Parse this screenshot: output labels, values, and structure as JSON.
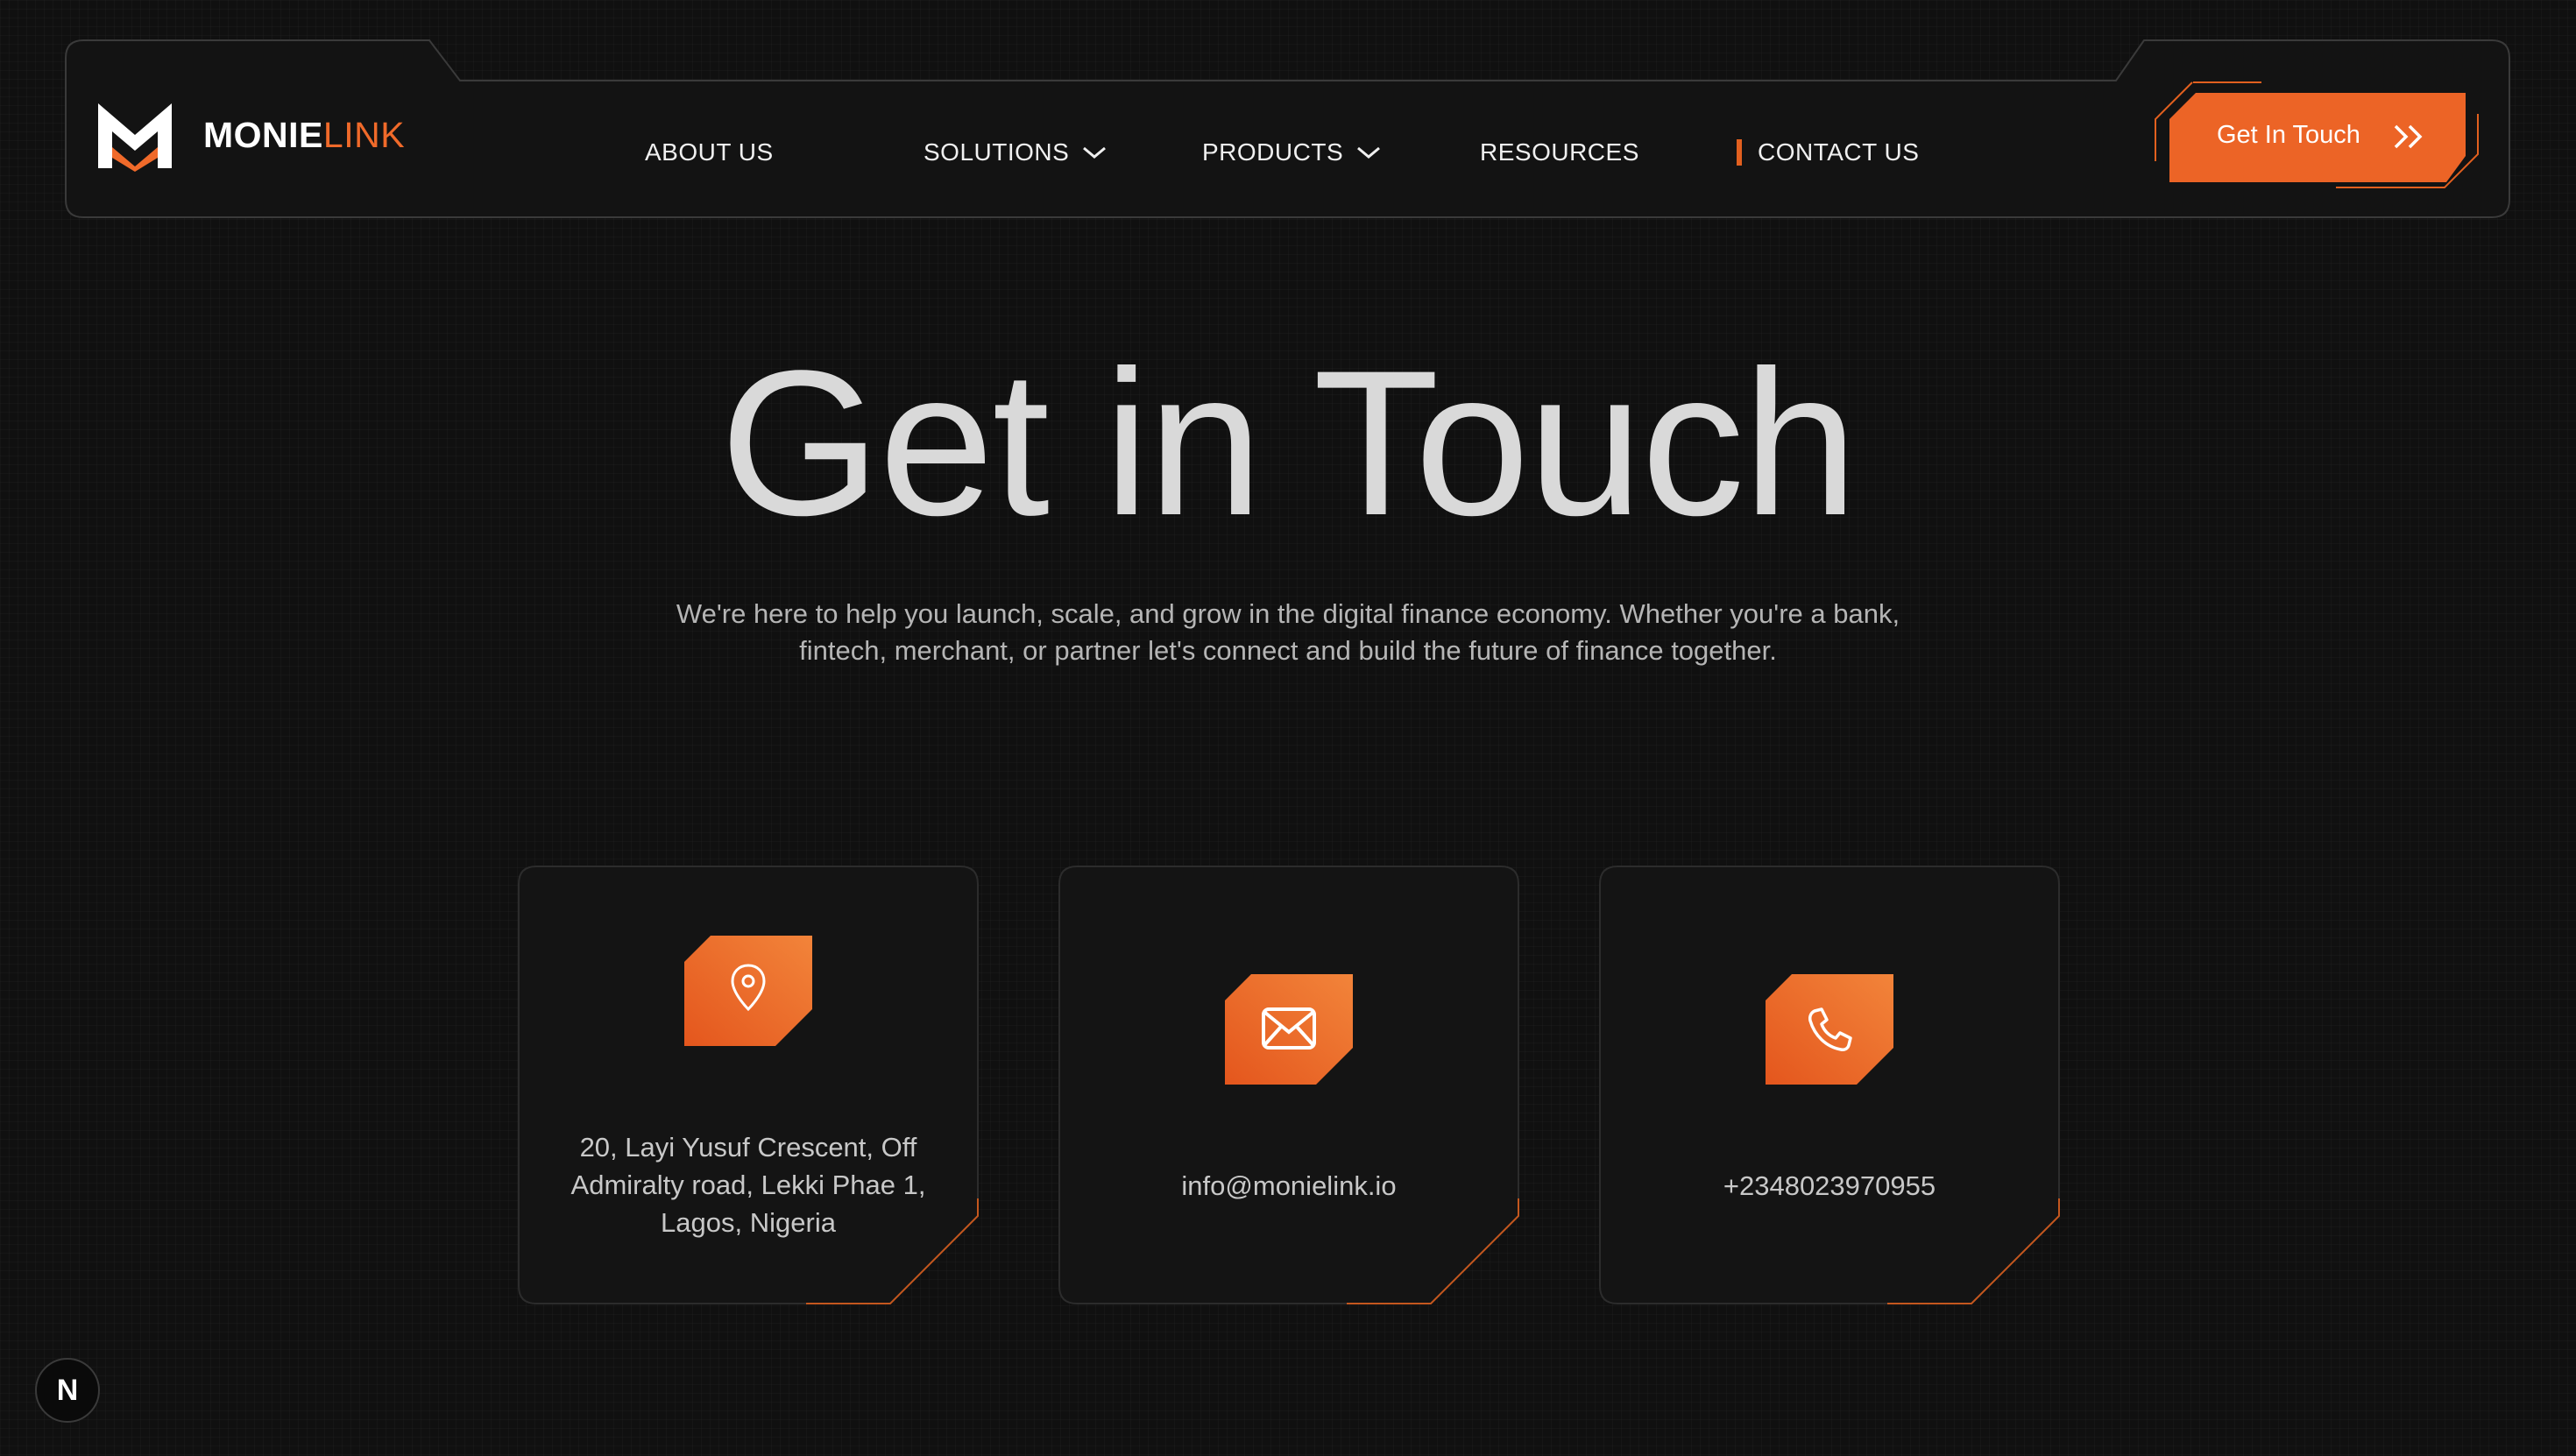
{
  "brand": {
    "name_bold": "MONIE",
    "name_light": "LINK",
    "accent_color": "#f06a2a"
  },
  "nav": {
    "items": [
      {
        "label": "ABOUT US",
        "has_dropdown": false,
        "active": false
      },
      {
        "label": "SOLUTIONS",
        "has_dropdown": true,
        "active": false
      },
      {
        "label": "PRODUCTS",
        "has_dropdown": true,
        "active": false
      },
      {
        "label": "RESOURCES",
        "has_dropdown": false,
        "active": false
      },
      {
        "label": "CONTACT US",
        "has_dropdown": false,
        "active": true
      }
    ],
    "cta_label": "Get In Touch",
    "cta_icon": "double-chevron-right-icon"
  },
  "hero": {
    "title": "Get in Touch",
    "subtitle": "We're here to help you launch, scale, and grow in the digital finance economy. Whether you're a bank, fintech, merchant, or partner let's connect and build the future of finance together."
  },
  "contacts": [
    {
      "icon": "location-pin-icon",
      "text": "20, Layi Yusuf Crescent, Off Admiralty road, Lekki Phae 1, Lagos, Nigeria"
    },
    {
      "icon": "mail-icon",
      "text": "info@monielink.io"
    },
    {
      "icon": "phone-icon",
      "text": "+2348023970955"
    }
  ],
  "badge": {
    "label": "N",
    "icon": "nextjs-icon"
  }
}
